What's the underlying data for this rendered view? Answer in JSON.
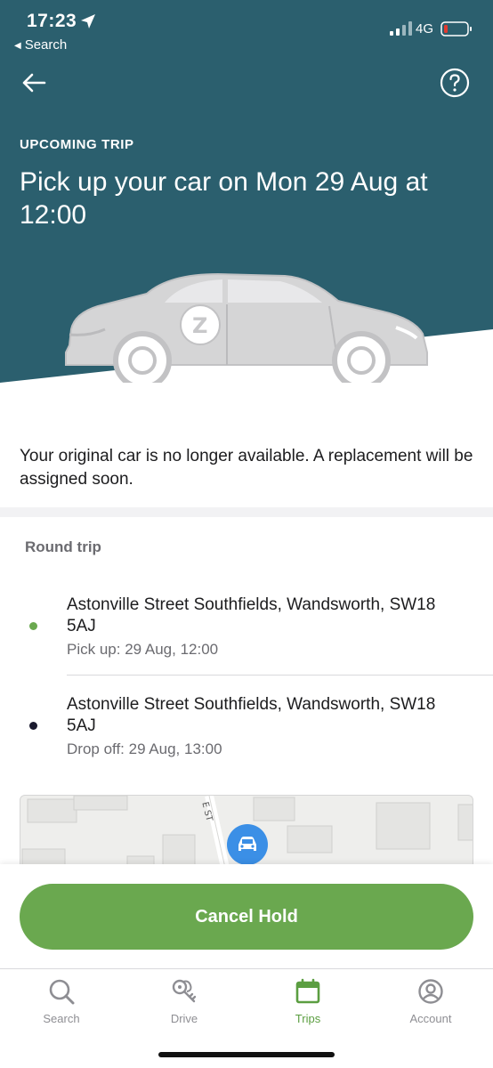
{
  "status_bar": {
    "time": "17:23",
    "back_app": "Search",
    "network": "4G"
  },
  "header": {
    "kicker": "UPCOMING TRIP",
    "title": "Pick up your car on Mon 29 Aug at 12:00",
    "background_color": "#2b5f6e"
  },
  "notice": "Your original car is no longer available. A replacement will be assigned soon.",
  "trip": {
    "type": "Round trip",
    "stops": [
      {
        "address": "Astonville Street Southfields, Wandsworth, SW18 5AJ",
        "time": "Pick up: 29 Aug, 12:00",
        "dot_color": "#6aa84f"
      },
      {
        "address": "Astonville Street Southfields, Wandsworth, SW18 5AJ",
        "time": "Drop off: 29 Aug, 13:00",
        "dot_color": "#1a1a2e"
      }
    ]
  },
  "map": {
    "street_label": "E ST"
  },
  "actions": {
    "cancel_label": "Cancel Hold",
    "button_color": "#6aa84f"
  },
  "tabbar": {
    "items": [
      {
        "label": "Search",
        "icon": "search-icon"
      },
      {
        "label": "Drive",
        "icon": "keys-icon"
      },
      {
        "label": "Trips",
        "icon": "calendar-icon",
        "active": true
      },
      {
        "label": "Account",
        "icon": "account-icon"
      }
    ],
    "active_color": "#5b9e41"
  }
}
